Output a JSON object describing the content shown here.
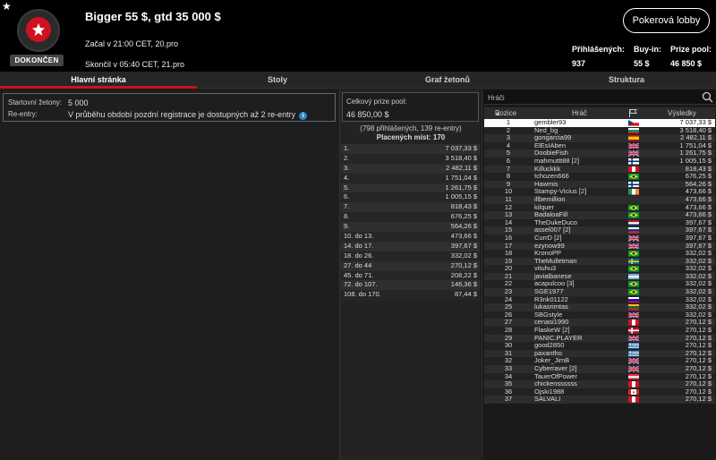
{
  "header": {
    "title": "Bigger 55 $, gtd 35 000 $",
    "status": "DOKONČEN",
    "started": "Začal v 21:00 CET, 20.pro",
    "ended": "Skončil v 05:40 CET, 21.pro",
    "lobby_button": "Pokerová lobby",
    "stats": [
      {
        "label": "Přihlášených:",
        "value": "937"
      },
      {
        "label": "Buy-in:",
        "value": "55 $"
      },
      {
        "label": "Prize pool:",
        "value": "46 850 $"
      }
    ]
  },
  "tabs": [
    {
      "label": "Hlavní stránka",
      "active": true
    },
    {
      "label": "Stoly",
      "active": false
    },
    {
      "label": "Graf žetonů",
      "active": false
    },
    {
      "label": "Struktura",
      "active": false
    }
  ],
  "info": {
    "starting_chips_label": "Startovní žetony:",
    "starting_chips_value": "5 000",
    "reentry_label": "Re-entry:",
    "reentry_value": "V průběhu období pozdní registrace je dostupných až 2 re-entry",
    "info_icon": "info-icon"
  },
  "prize": {
    "pool_label": "Celkový prize pool:",
    "pool_value": "46 850,00 $",
    "entries": "(798 přihlášených, 139 re-entry)",
    "paid": "Placených míst: 170",
    "payouts": [
      {
        "place": "1.",
        "amount": "7 037,33 $"
      },
      {
        "place": "2.",
        "amount": "3 518,40 $"
      },
      {
        "place": "3.",
        "amount": "2 482,11 $"
      },
      {
        "place": "4.",
        "amount": "1 751,04 $"
      },
      {
        "place": "5.",
        "amount": "1 261,75 $"
      },
      {
        "place": "6.",
        "amount": "1 005,15 $"
      },
      {
        "place": "7.",
        "amount": "818,43 $"
      },
      {
        "place": "8.",
        "amount": "676,25 $"
      },
      {
        "place": "9.",
        "amount": "564,26 $"
      },
      {
        "place": "10. do 13.",
        "amount": "473,66 $"
      },
      {
        "place": "14. do 17.",
        "amount": "397,67 $"
      },
      {
        "place": "18. do 26.",
        "amount": "332,02 $"
      },
      {
        "place": "27. do 44",
        "amount": "270,12 $"
      },
      {
        "place": "45. do 71.",
        "amount": "208,22 $"
      },
      {
        "place": "72. do 107.",
        "amount": "146,36 $"
      },
      {
        "place": "108. do 170.",
        "amount": "87,44 $"
      }
    ]
  },
  "players": {
    "search_placeholder": "Hráči",
    "col_position": "Pozice",
    "col_player": "Hráč",
    "col_results": "Výsledky",
    "rows": [
      {
        "pos": "1",
        "name": "gembler93",
        "flag": "cz",
        "result": "7 037,33 $",
        "selected": true
      },
      {
        "pos": "2",
        "name": "Ned_bg",
        "flag": "bg",
        "result": "3 518,40 $"
      },
      {
        "pos": "3",
        "name": "gongarcia99",
        "flag": "es",
        "result": "2 482,11 $"
      },
      {
        "pos": "4",
        "name": "ElEsIAben",
        "flag": "gb",
        "result": "1 751,04 $"
      },
      {
        "pos": "5",
        "name": "DoobieFish",
        "flag": "gb",
        "result": "1 261,75 $"
      },
      {
        "pos": "6",
        "name": "mahmuttt88 [2]",
        "flag": "fi",
        "result": "1 005,15 $"
      },
      {
        "pos": "7",
        "name": "Killuckkk",
        "flag": "pe",
        "result": "818,43 $"
      },
      {
        "pos": "8",
        "name": "tchozen666",
        "flag": "br",
        "result": "676,25 $"
      },
      {
        "pos": "9",
        "name": "Hawmis",
        "flag": "fi",
        "result": "564,26 $"
      },
      {
        "pos": "10",
        "name": "Stampy-Vicius [2]",
        "flag": "ie",
        "result": "473,66 $"
      },
      {
        "pos": "11",
        "name": "illbemillion",
        "flag": "none",
        "result": "473,66 $"
      },
      {
        "pos": "12",
        "name": "kilquer",
        "flag": "br",
        "result": "473,66 $"
      },
      {
        "pos": "13",
        "name": "BadaloaFill",
        "flag": "br",
        "result": "473,66 $"
      },
      {
        "pos": "14",
        "name": "TheDukeDuco",
        "flag": "nl",
        "result": "397,67 $"
      },
      {
        "pos": "15",
        "name": "assel007 [2]",
        "flag": "ru",
        "result": "397,67 $"
      },
      {
        "pos": "16",
        "name": "CurrD [2]",
        "flag": "gb",
        "result": "397,67 $"
      },
      {
        "pos": "17",
        "name": "ezynow99",
        "flag": "gb",
        "result": "397,67 $"
      },
      {
        "pos": "18",
        "name": "KronoPP",
        "flag": "br",
        "result": "332,02 $"
      },
      {
        "pos": "19",
        "name": "TheMulletman",
        "flag": "se",
        "result": "332,02 $"
      },
      {
        "pos": "20",
        "name": "vituhu3",
        "flag": "br",
        "result": "332,02 $"
      },
      {
        "pos": "21",
        "name": "javialbanese",
        "flag": "ar",
        "result": "332,02 $"
      },
      {
        "pos": "22",
        "name": "acapulcoo [3]",
        "flag": "br",
        "result": "332,02 $"
      },
      {
        "pos": "23",
        "name": "SGE1977",
        "flag": "br",
        "result": "332,02 $"
      },
      {
        "pos": "24",
        "name": "R3nk01122",
        "flag": "si",
        "result": "332,02 $"
      },
      {
        "pos": "25",
        "name": "lukasrimtas",
        "flag": "lt",
        "result": "332,02 $"
      },
      {
        "pos": "26",
        "name": "SBGstyle",
        "flag": "gb",
        "result": "332,02 $"
      },
      {
        "pos": "27",
        "name": "cenasi1990",
        "flag": "pe",
        "result": "270,12 $"
      },
      {
        "pos": "28",
        "name": "FlaskeW [2]",
        "flag": "dk",
        "result": "270,12 $"
      },
      {
        "pos": "29",
        "name": "PANIC.PLAYER",
        "flag": "gb",
        "result": "270,12 $"
      },
      {
        "pos": "30",
        "name": "good2850",
        "flag": "gr",
        "result": "270,12 $"
      },
      {
        "pos": "31",
        "name": "paxantho",
        "flag": "gr",
        "result": "270,12 $"
      },
      {
        "pos": "32",
        "name": "Joker_JimB",
        "flag": "gb",
        "result": "270,12 $"
      },
      {
        "pos": "33",
        "name": "Cyberraver [2]",
        "flag": "gb",
        "result": "270,12 $"
      },
      {
        "pos": "34",
        "name": "TauerOfPower",
        "flag": "at",
        "result": "270,12 $"
      },
      {
        "pos": "35",
        "name": "chickenssssss",
        "flag": "pe",
        "result": "270,12 $"
      },
      {
        "pos": "36",
        "name": "Ojski1988",
        "flag": "ca",
        "result": "270,12 $"
      },
      {
        "pos": "37",
        "name": "SALVALI",
        "flag": "pe",
        "result": "270,12 $"
      }
    ]
  }
}
